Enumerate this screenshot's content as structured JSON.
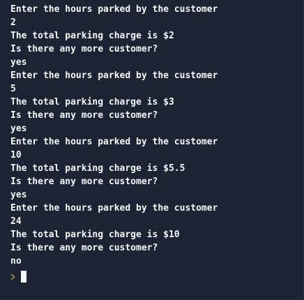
{
  "console": {
    "lines": [
      "Enter the hours parked by the customer",
      "2",
      "The total parking charge is $2",
      "Is there any more customer?",
      "yes",
      "Enter the hours parked by the customer",
      "5",
      "The total parking charge is $3",
      "Is there any more customer?",
      "yes",
      "Enter the hours parked by the customer",
      "10",
      "The total parking charge is $5.5",
      "Is there any more customer?",
      "yes",
      "Enter the hours parked by the customer",
      "24",
      "The total parking charge is $10",
      "Is there any more customer?",
      "no"
    ],
    "prompt_icon": "chevron-right-icon",
    "prompt_color": "#a38b3a",
    "background_color": "#1c2333",
    "text_color": "#f5f9fc"
  }
}
